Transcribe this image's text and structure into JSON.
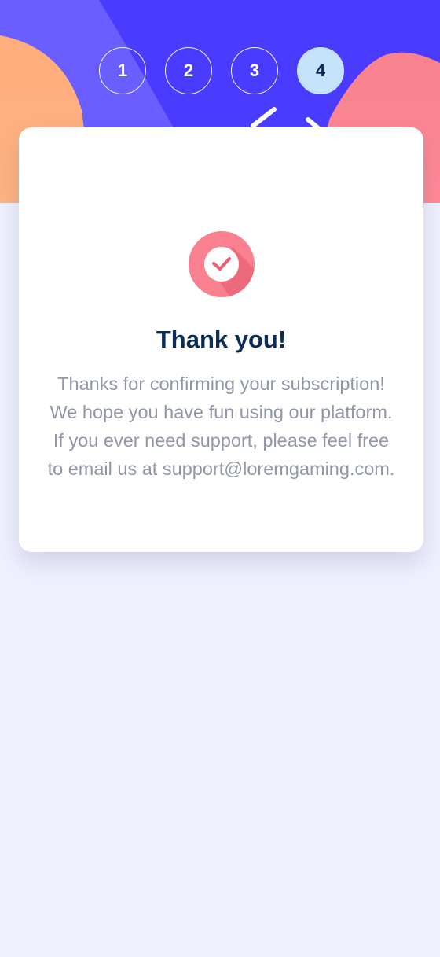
{
  "steps": [
    {
      "label": "1",
      "active": false
    },
    {
      "label": "2",
      "active": false
    },
    {
      "label": "3",
      "active": false
    },
    {
      "label": "4",
      "active": true
    }
  ],
  "confirmation": {
    "icon": "check-circle-icon",
    "title": "Thank you!",
    "message": "Thanks for confirming your subscription! We hope you have fun using our platform. If you ever need support, please feel free to email us at support@loremgaming.com."
  },
  "colors": {
    "hero_background": "#4a3cff",
    "active_step": "#c4e3fb",
    "title": "#0d2b57",
    "message": "#9097a8",
    "badge": "#f8808f"
  }
}
